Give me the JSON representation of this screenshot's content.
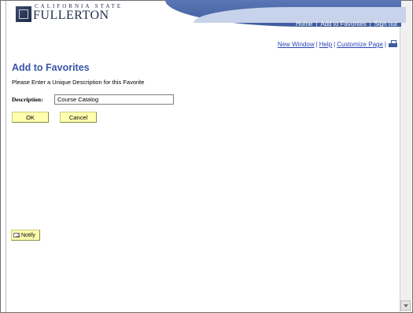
{
  "header": {
    "logo_small": "CALIFORNIA STATE",
    "logo_name": "FULLERTON",
    "top_links": [
      "Home",
      "Add to Favorites",
      "Sign out"
    ]
  },
  "utility": {
    "links": [
      "New Window",
      "Help",
      "Customize Page"
    ],
    "print_icon": "print-icon"
  },
  "main": {
    "title": "Add to Favorites",
    "instructions": "Please Enter a Unique Description for this Favorite",
    "description_label": "Description:",
    "description_value": "Course Catalog",
    "ok_label": "OK",
    "cancel_label": "Cancel"
  },
  "footer": {
    "notify_label": "Notify",
    "notify_icon": "envelope-icon"
  },
  "colors": {
    "title": "#3b56a8",
    "link": "#2a44b8",
    "button_bg": "#ffffb0",
    "header_band": "#4a67a8"
  }
}
